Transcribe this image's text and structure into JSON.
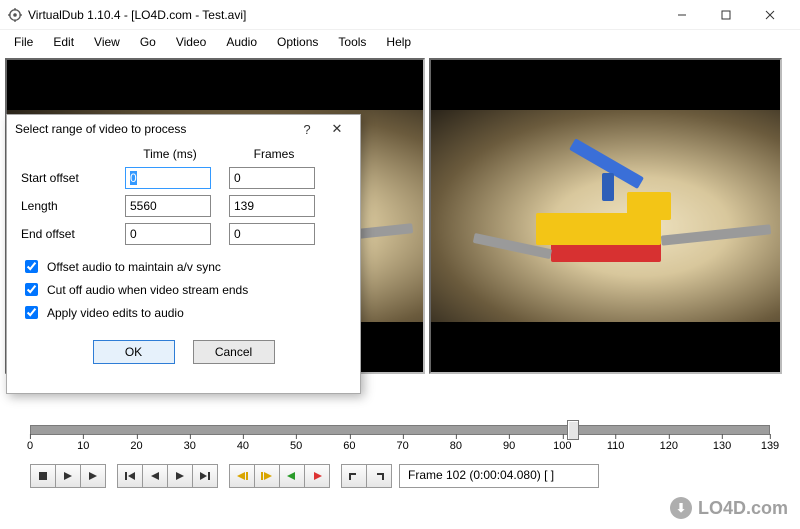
{
  "window": {
    "title": "VirtualDub 1.10.4 - [LO4D.com - Test.avi]"
  },
  "menu": {
    "file": "File",
    "edit": "Edit",
    "view": "View",
    "go": "Go",
    "video": "Video",
    "audio": "Audio",
    "options": "Options",
    "tools": "Tools",
    "help": "Help"
  },
  "dialog": {
    "title": "Select range of video to process",
    "help_symbol": "?",
    "close_symbol": "✕",
    "col_time": "Time (ms)",
    "col_frames": "Frames",
    "row_start": "Start offset",
    "row_length": "Length",
    "row_end": "End offset",
    "start_time": "0",
    "start_frames": "0",
    "length_time": "5560",
    "length_frames": "139",
    "end_time": "0",
    "end_frames": "0",
    "chk_offset_audio": "Offset audio to maintain a/v sync",
    "chk_cut_audio": "Cut off audio when video stream ends",
    "chk_apply_edits": "Apply video edits to audio",
    "btn_ok": "OK",
    "btn_cancel": "Cancel"
  },
  "timeline": {
    "min": 0,
    "max": 139,
    "current": 102,
    "ticks": [
      0,
      10,
      20,
      30,
      40,
      50,
      60,
      70,
      80,
      90,
      100,
      110,
      120,
      130,
      139
    ]
  },
  "status": {
    "frame_text": "Frame 102 (0:00:04.080) [ ]"
  },
  "watermark": {
    "text": "LO4D.com"
  }
}
